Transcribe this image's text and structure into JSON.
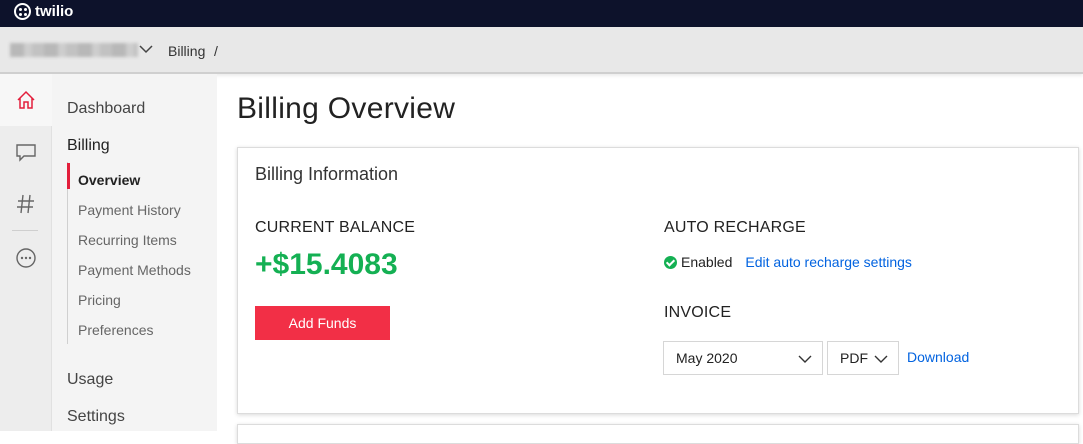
{
  "brand": {
    "name": "twilio"
  },
  "breadcrumb": {
    "current": "Billing",
    "separator": "/"
  },
  "rail": {
    "icons": [
      "home-icon",
      "chat-icon",
      "hash-icon",
      "more-icon"
    ],
    "active": "home-icon"
  },
  "subnav": {
    "top_items": [
      {
        "label": "Dashboard"
      },
      {
        "label": "Billing"
      }
    ],
    "billing_items": [
      {
        "label": "Overview"
      },
      {
        "label": "Payment History"
      },
      {
        "label": "Recurring Items"
      },
      {
        "label": "Payment Methods"
      },
      {
        "label": "Pricing"
      },
      {
        "label": "Preferences"
      }
    ],
    "bottom_items": [
      {
        "label": "Usage"
      },
      {
        "label": "Settings"
      }
    ]
  },
  "page": {
    "title": "Billing Overview"
  },
  "billing_info": {
    "title": "Billing Information",
    "balance_label": "CURRENT BALANCE",
    "balance_value": "+$15.4083",
    "add_funds_label": "Add Funds",
    "auto_recharge_label": "AUTO RECHARGE",
    "auto_recharge_status": "Enabled",
    "edit_link": "Edit auto recharge settings",
    "invoice_label": "INVOICE",
    "invoice_month": "May 2020",
    "invoice_format": "PDF",
    "download_label": "Download"
  },
  "colors": {
    "accent": "#f22f46",
    "success": "#14b053",
    "link": "#0263e0",
    "topbar": "#0d122b"
  }
}
